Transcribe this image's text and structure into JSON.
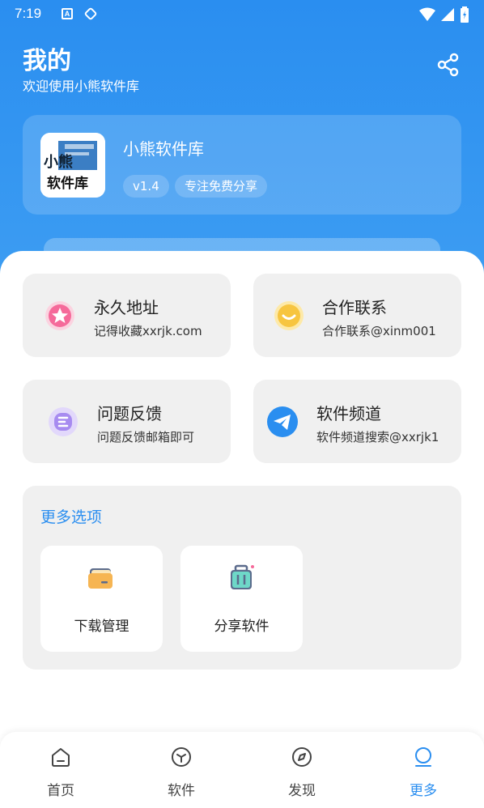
{
  "status_bar": {
    "time": "7:19",
    "notif_icon": "A"
  },
  "header": {
    "title": "我的",
    "subtitle": "欢迎使用小熊软件库"
  },
  "app": {
    "name": "小熊软件库",
    "version": "v1.4",
    "tag": "专注免费分享",
    "logo_text_top": "小熊",
    "logo_text_bottom": "软件库"
  },
  "info_cards": [
    {
      "title": "永久地址",
      "subtitle": "记得收藏xxrjk.com",
      "icon": "star-icon",
      "color": "#f56a9a"
    },
    {
      "title": "合作联系",
      "subtitle": "合作联系@xinm001",
      "icon": "chat-smile-icon",
      "color": "#f7c540"
    },
    {
      "title": "问题反馈",
      "subtitle": "问题反馈邮箱即可",
      "icon": "feedback-icon",
      "color": "#a78bf0"
    },
    {
      "title": "软件频道",
      "subtitle": "软件频道搜索@xxrjk1",
      "icon": "telegram-icon",
      "color": "#2a8ef0"
    }
  ],
  "more_options": {
    "title": "更多选项",
    "items": [
      {
        "label": "下载管理",
        "icon": "folder-icon"
      },
      {
        "label": "分享软件",
        "icon": "suitcase-icon"
      }
    ]
  },
  "bottom_nav": {
    "items": [
      {
        "label": "首页",
        "icon": "home-icon"
      },
      {
        "label": "软件",
        "icon": "box-icon"
      },
      {
        "label": "发现",
        "icon": "compass-icon"
      },
      {
        "label": "更多",
        "icon": "user-icon"
      }
    ],
    "active": "更多"
  },
  "colors": {
    "primary": "#2a8ef0",
    "card_bg": "#f0f0f0"
  }
}
